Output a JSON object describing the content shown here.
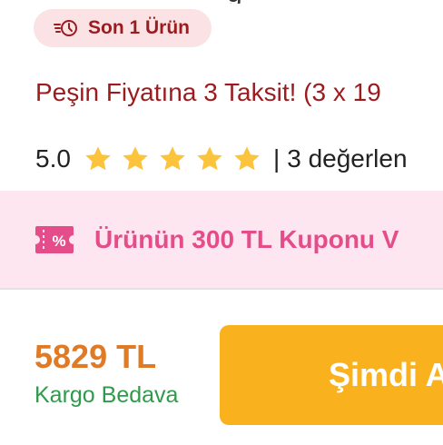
{
  "badge": {
    "icon": "clock-icon",
    "label": "Son 1 Ürün"
  },
  "product": {
    "title": "Peşin Fiyatına 3 Taksit! (3 x 19",
    "rating": "5.0",
    "stars": 5,
    "separator": "|",
    "reviews": "3 değerlen"
  },
  "coupon": {
    "icon": "coupon-icon",
    "text": "Ürünün 300 TL Kuponu V"
  },
  "purchase": {
    "price": "5829 TL",
    "shipping": "Kargo Bedava",
    "buy_label": "Şimdi A"
  },
  "colors": {
    "accent_red": "#9b1c1f",
    "badge_bg": "#fbe3e5",
    "coupon_pink": "#e54c8a",
    "coupon_bg": "#fde6ef",
    "price_orange": "#e07a25",
    "shipping_green": "#2f9a4b",
    "button_yellow": "#f9b21d",
    "star_yellow": "#fcc43d"
  }
}
